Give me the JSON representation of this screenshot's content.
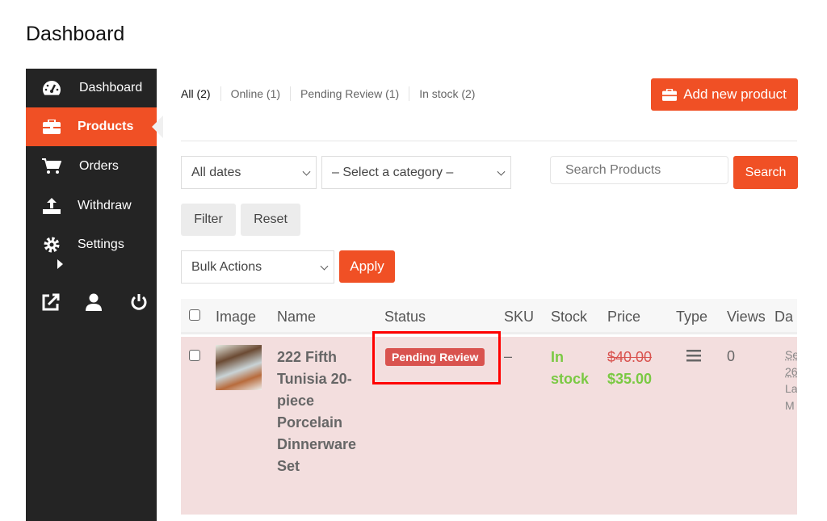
{
  "page_title": "Dashboard",
  "colors": {
    "accent": "#f05025",
    "sidebar": "#242424",
    "pending_badge": "#d9534f",
    "in_stock": "#7ac943",
    "row_bg": "#f3dede",
    "highlight_box": "#ff0000"
  },
  "sidebar": {
    "items": [
      {
        "label": "Dashboard",
        "icon": "dashboard-gauge-icon"
      },
      {
        "label": "Products",
        "icon": "briefcase-icon",
        "active": true
      },
      {
        "label": "Orders",
        "icon": "cart-icon"
      },
      {
        "label": "Withdraw",
        "icon": "upload-icon"
      },
      {
        "label": "Settings",
        "icon": "gear-icon"
      }
    ],
    "bottom_icons": [
      "external-link-icon",
      "user-icon",
      "power-icon"
    ]
  },
  "filters": {
    "tabs": [
      "All (2)",
      "Online (1)",
      "Pending Review (1)",
      "In stock (2)"
    ],
    "add_new_label": "Add new product",
    "dates": "All dates",
    "category": "– Select a category –",
    "search_placeholder": "Search Products",
    "search_label": "Search",
    "filter_label": "Filter",
    "reset_label": "Reset",
    "bulk": "Bulk Actions",
    "apply_label": "Apply"
  },
  "table": {
    "headers": [
      "Image",
      "Name",
      "Status",
      "SKU",
      "Stock",
      "Price",
      "Type",
      "Views",
      "Da"
    ],
    "rows": [
      {
        "name": "222 Fifth Tunisia 20-piece Porcelain Dinnerware Set",
        "status": "Pending Review",
        "sku": "–",
        "stock_1": "In",
        "stock_2": "stock",
        "regular_price": "$40.00",
        "sale_price": "$35.00",
        "type_icon": "menu-lines-icon",
        "views": "0",
        "date_fragments": [
          "Se",
          "26",
          "La",
          "M"
        ]
      }
    ]
  }
}
